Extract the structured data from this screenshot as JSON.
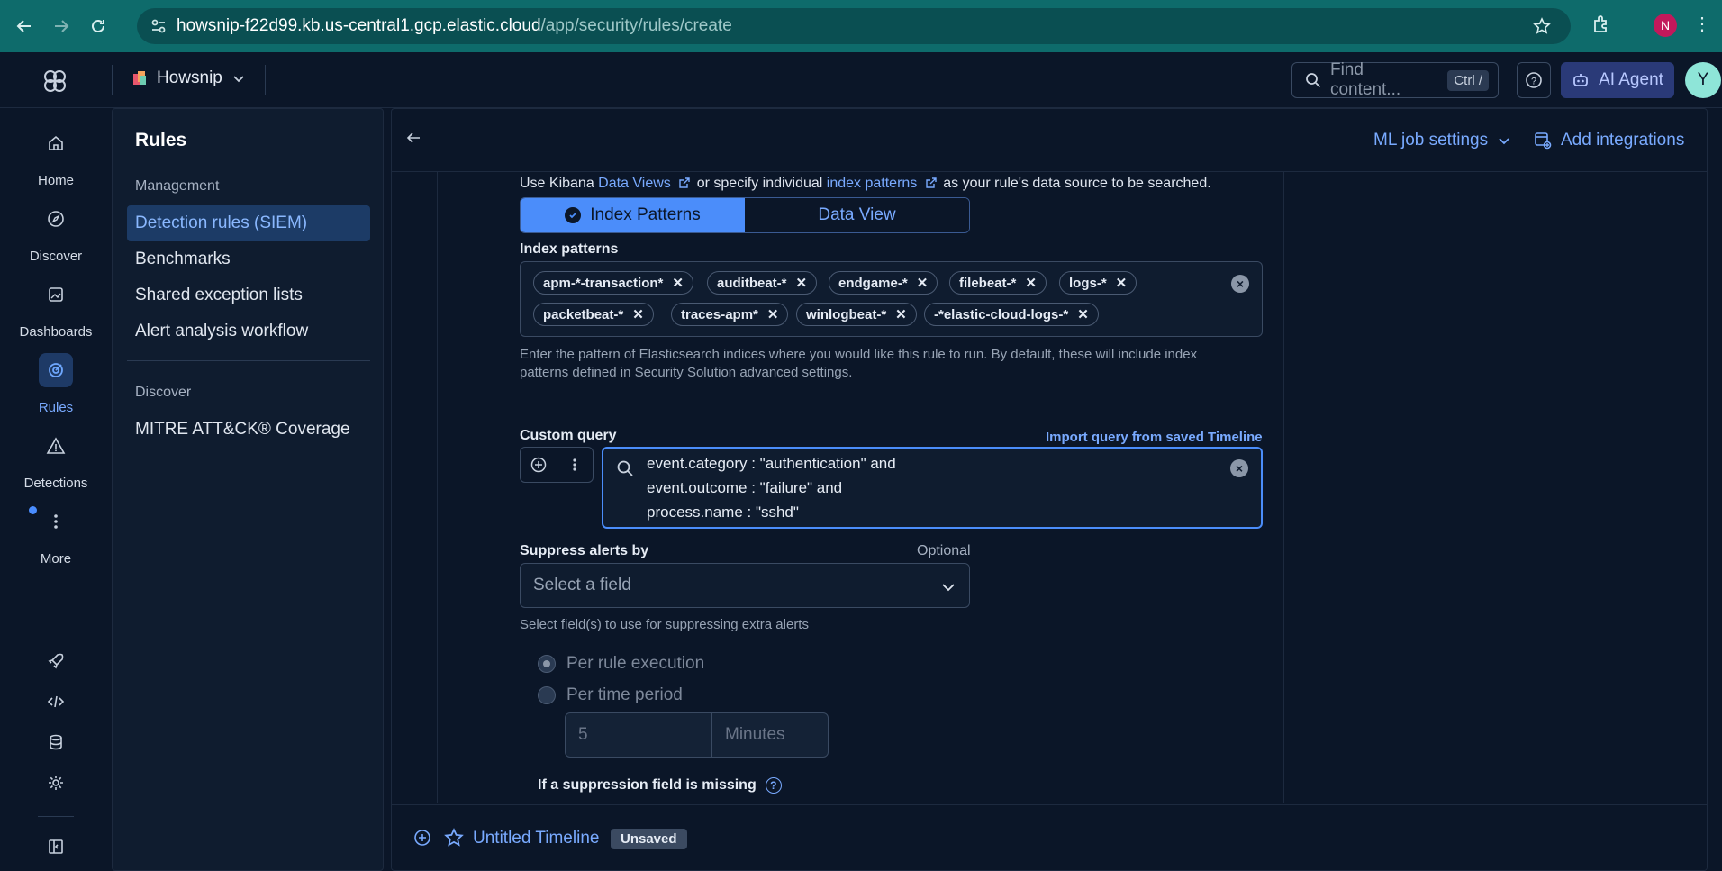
{
  "browser": {
    "url_host": "howsnip-f22d99.kb.us-central1.gcp.elastic.cloud",
    "url_path": "/app/security/rules/create",
    "profile_initial": "N"
  },
  "header": {
    "space_name": "Howsnip",
    "search_placeholder": "Find content...",
    "search_shortcut": "Ctrl /",
    "ai_agent_label": "AI Agent",
    "user_initial": "Y"
  },
  "rail": {
    "items": [
      {
        "label": "Home",
        "icon": "home-icon"
      },
      {
        "label": "Discover",
        "icon": "discover-icon"
      },
      {
        "label": "Dashboards",
        "icon": "dashboards-icon"
      },
      {
        "label": "Rules",
        "icon": "rules-icon"
      },
      {
        "label": "Detections",
        "icon": "detections-icon"
      },
      {
        "label": "More",
        "icon": "more-icon"
      }
    ],
    "tools": [
      "rocket-icon",
      "code-icon",
      "database-icon",
      "gear-icon",
      "collapse-icon"
    ]
  },
  "sidenav": {
    "title": "Rules",
    "section_management": "Management",
    "items": [
      "Detection rules (SIEM)",
      "Benchmarks",
      "Shared exception lists",
      "Alert analysis workflow"
    ],
    "section_discover": "Discover",
    "discover_items": [
      "MITRE ATT&CK® Coverage"
    ]
  },
  "topbar": {
    "ml_job_settings": "ML job settings",
    "add_integrations": "Add integrations"
  },
  "form": {
    "datasource_text_1": "Use Kibana ",
    "datasource_link_1": "Data Views",
    "datasource_text_2": " or specify individual ",
    "datasource_link_2": "index patterns",
    "datasource_text_3": " as your rule's data source to be searched.",
    "toggle_index_patterns": "Index Patterns",
    "toggle_data_view": "Data View",
    "index_patterns_label": "Index patterns",
    "index_patterns": [
      "apm-*-transaction*",
      "auditbeat-*",
      "endgame-*",
      "filebeat-*",
      "logs-*",
      "packetbeat-*",
      "traces-apm*",
      "winlogbeat-*",
      "-*elastic-cloud-logs-*"
    ],
    "index_help_line_1": "Enter the pattern of Elasticsearch indices where you would like this rule to run. By default, these will include index",
    "index_help_line_2": "patterns defined in Security Solution advanced settings.",
    "custom_query_label": "Custom query",
    "import_query": "Import query from saved Timeline",
    "query_lines": [
      "event.category : \"authentication\" and",
      "event.outcome : \"failure\" and",
      "process.name : \"sshd\""
    ],
    "suppress_label": "Suppress alerts by",
    "optional": "Optional",
    "select_placeholder": "Select a field",
    "suppress_help": "Select field(s) to use for suppressing extra alerts",
    "radio_per_rule": "Per rule execution",
    "radio_per_time": "Per time period",
    "duration_value": "5",
    "duration_unit": "Minutes",
    "missing_label": "If a suppression field is missing"
  },
  "timeline": {
    "title": "Untitled Timeline",
    "badge": "Unsaved"
  },
  "colors": {
    "accent": "#4b8dfa",
    "link": "#79aaff",
    "browser_bar": "#0e6b6b",
    "background": "#0b1628"
  }
}
